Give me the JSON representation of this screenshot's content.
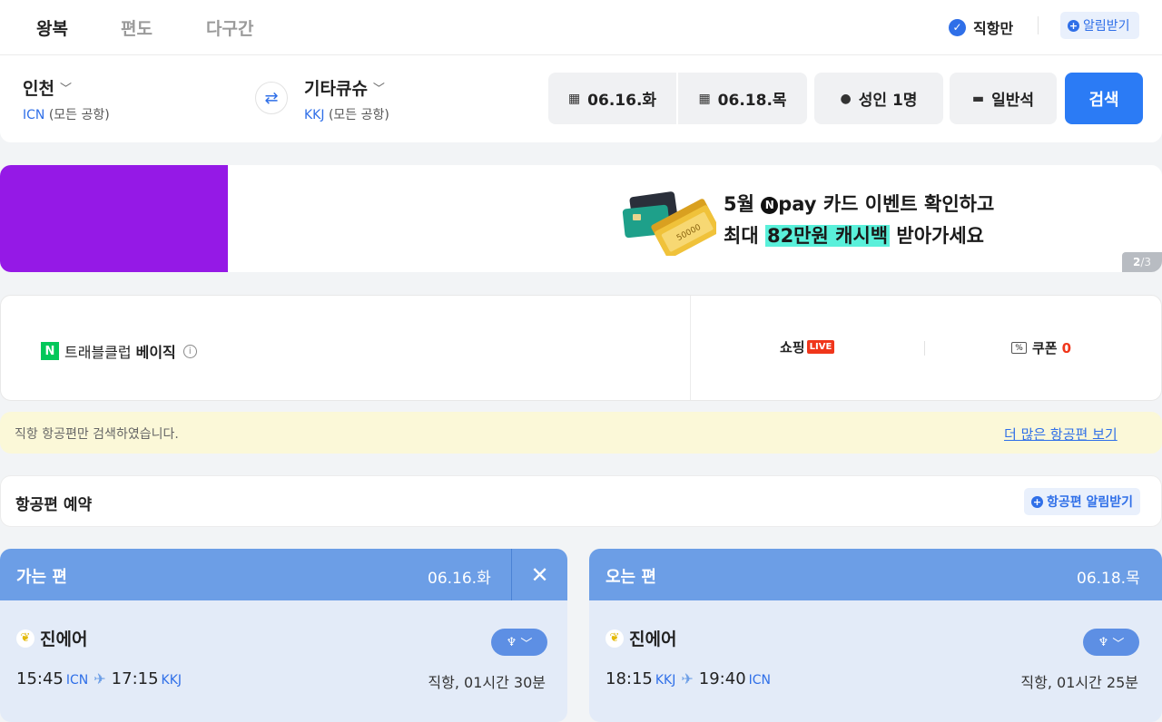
{
  "tabs": [
    "왕복",
    "편도",
    "다구간"
  ],
  "header": {
    "direct_only_label": "직항만",
    "alert_label": "알림받기"
  },
  "search": {
    "origin": {
      "city": "인천",
      "code": "ICN",
      "suffix": "(모든 공항)"
    },
    "destination": {
      "city": "기타큐슈",
      "code": "KKJ",
      "suffix": "(모든 공항)"
    },
    "depart_date": "06.16.화",
    "return_date": "06.18.목",
    "passengers": "성인 1명",
    "cabin": "일반석",
    "search_button": "검색"
  },
  "banner": {
    "line1_prefix": "5월",
    "npay_letter": "N",
    "line1_brand": "pay",
    "line1_suffix": "카드 이벤트 확인하고",
    "line2_prefix": "최대",
    "line2_highlight": "82만원 캐시백",
    "line2_suffix": "받아가세요",
    "pager_current": "2",
    "pager_total": "/3",
    "bill_label": "50000"
  },
  "membership": {
    "logo": "N",
    "label": "트래블클럽",
    "tier": "베이직",
    "info": "i",
    "shopping": "쇼핑",
    "live": "LIVE",
    "coupon_icon": "%",
    "coupon_label": "쿠폰",
    "coupon_count": "0"
  },
  "notice": {
    "text": "직항 항공편만 검색하였습니다.",
    "link": "더 많은 항공편 보기"
  },
  "booking": {
    "title": "항공편 예약",
    "alert": "항공편 알림받기"
  },
  "outbound": {
    "direction": "가는 편",
    "date": "06.16.화",
    "airline": "진에어",
    "depart_time": "15:45",
    "depart_code": "ICN",
    "arrive_time": "17:15",
    "arrive_code": "KKJ",
    "duration": "직항, 01시간 30분"
  },
  "inbound": {
    "direction": "오는 편",
    "date": "06.18.목",
    "airline": "진에어",
    "depart_time": "18:15",
    "depart_code": "KKJ",
    "arrive_time": "19:40",
    "arrive_code": "ICN",
    "duration": "직항, 01시간 25분"
  },
  "colors": {
    "accent": "#2b7bf5",
    "banner_purple": "#9519e6",
    "card_header": "#6c9ee6",
    "card_body": "#e3ebf8",
    "notice_bg": "#fbf8d8",
    "highlight": "#5af0da",
    "live_red": "#f0361b"
  }
}
